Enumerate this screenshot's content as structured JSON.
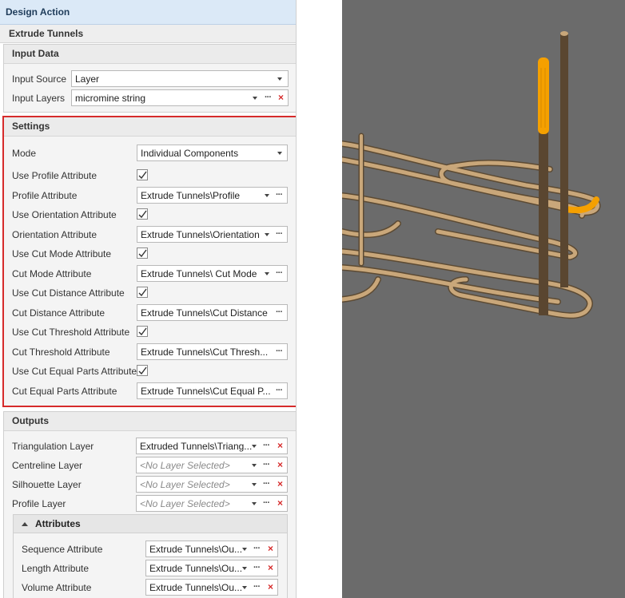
{
  "window": {
    "title": "Design Action",
    "subtitle": "Extrude Tunnels"
  },
  "input_data": {
    "title": "Input Data",
    "rows": [
      {
        "label": "Input Source",
        "value": "Layer"
      },
      {
        "label": "Input Layers",
        "value": "micromine string"
      }
    ]
  },
  "settings": {
    "title": "Settings",
    "mode": {
      "label": "Mode",
      "value": "Individual Components"
    },
    "use_profile": {
      "label": "Use Profile Attribute",
      "checked": true
    },
    "profile": {
      "label": "Profile Attribute",
      "value": "Extrude Tunnels\\Profile"
    },
    "use_orientation": {
      "label": "Use Orientation Attribute",
      "checked": true
    },
    "orientation": {
      "label": "Orientation Attribute",
      "value": "Extrude Tunnels\\Orientation"
    },
    "use_cut_mode": {
      "label": "Use Cut Mode Attribute",
      "checked": true
    },
    "cut_mode": {
      "label": "Cut Mode Attribute",
      "value": "Extrude Tunnels\\ Cut Mode"
    },
    "use_cut_distance": {
      "label": "Use Cut Distance Attribute",
      "checked": true
    },
    "cut_distance": {
      "label": "Cut Distance Attribute",
      "value": "Extrude Tunnels\\Cut Distance"
    },
    "use_cut_threshold": {
      "label": "Use Cut Threshold Attribute",
      "checked": true
    },
    "cut_threshold": {
      "label": "Cut Threshold Attribute",
      "value": "Extrude Tunnels\\Cut Thresh..."
    },
    "use_cut_equal": {
      "label": "Use Cut Equal Parts Attribute",
      "checked": true
    },
    "cut_equal": {
      "label": "Cut Equal Parts Attribute",
      "value": "Extrude Tunnels\\Cut Equal P..."
    }
  },
  "outputs": {
    "title": "Outputs",
    "triangulation": {
      "label": "Triangulation Layer",
      "value": "Extruded Tunnels\\Triang..."
    },
    "centreline": {
      "label": "Centreline Layer",
      "value": "<No Layer Selected>"
    },
    "silhouette": {
      "label": "Silhouette Layer",
      "value": "<No Layer Selected>"
    },
    "profile": {
      "label": "Profile Layer",
      "value": "<No Layer Selected>"
    }
  },
  "attributes": {
    "title": "Attributes",
    "sequence": {
      "label": "Sequence Attribute",
      "value": "Extrude Tunnels\\Ou..."
    },
    "length": {
      "label": "Length Attribute",
      "value": "Extrude Tunnels\\Ou..."
    },
    "volume": {
      "label": "Volume Attribute",
      "value": "Extrude Tunnels\\Ou..."
    }
  },
  "glyphs": {
    "dots": "···",
    "clear": "×"
  },
  "colors": {
    "selection_border": "#d62b2b",
    "clear_icon": "#d62b2b",
    "tunnel": "#c9a77a",
    "highlight": "#f5a000",
    "drillhole": "#5a4630",
    "viewport_bg": "#6b6b6b"
  }
}
